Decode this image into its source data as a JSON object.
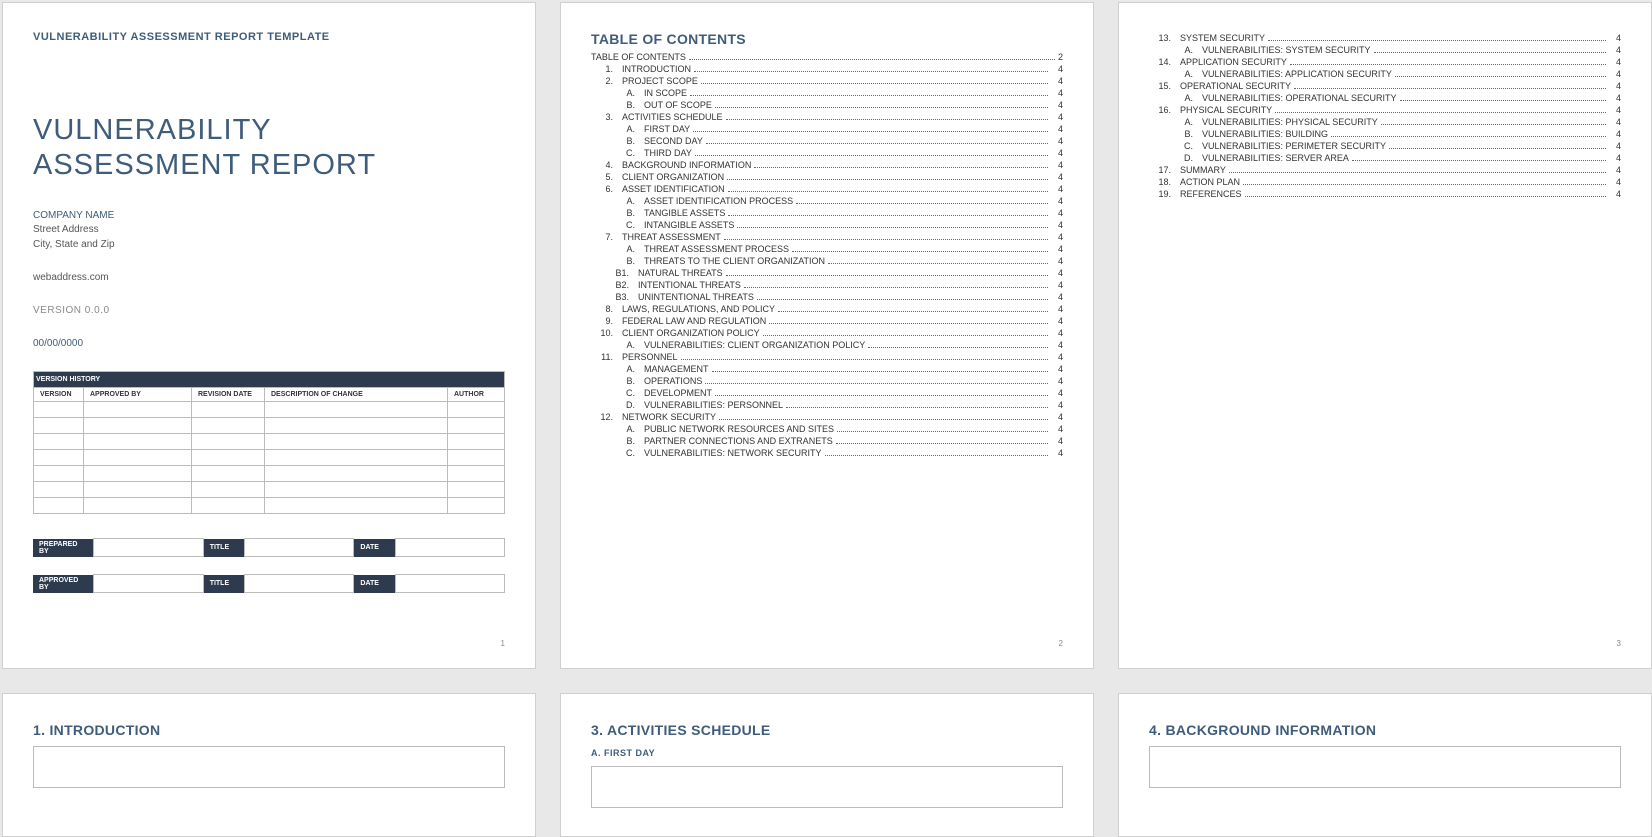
{
  "page1": {
    "header": "VULNERABILITY ASSESSMENT REPORT TEMPLATE",
    "title_line1": "VULNERABILITY",
    "title_line2": "ASSESSMENT REPORT",
    "company": "COMPANY NAME",
    "street": "Street Address",
    "citystatezip": "City, State and Zip",
    "web": "webaddress.com",
    "version": "VERSION 0.0.0",
    "date": "00/00/0000",
    "version_history": {
      "title": "VERSION HISTORY",
      "columns": [
        "VERSION",
        "APPROVED BY",
        "REVISION DATE",
        "DESCRIPTION OF CHANGE",
        "AUTHOR"
      ],
      "rows": [
        [
          "",
          "",
          "",
          "",
          ""
        ],
        [
          "",
          "",
          "",
          "",
          ""
        ],
        [
          "",
          "",
          "",
          "",
          ""
        ],
        [
          "",
          "",
          "",
          "",
          ""
        ],
        [
          "",
          "",
          "",
          "",
          ""
        ],
        [
          "",
          "",
          "",
          "",
          ""
        ],
        [
          "",
          "",
          "",
          "",
          ""
        ]
      ]
    },
    "signoff": {
      "prepared_by": "PREPARED BY",
      "approved_by": "APPROVED BY",
      "title": "TITLE",
      "date": "DATE"
    }
  },
  "toc": {
    "title": "TABLE OF CONTENTS",
    "table_of_contents_self": {
      "label": "TABLE OF CONTENTS",
      "page": "2"
    },
    "page2": [
      {
        "num": "1.",
        "label": "INTRODUCTION",
        "page": "4"
      },
      {
        "num": "2.",
        "label": "PROJECT SCOPE",
        "page": "4"
      },
      {
        "num": "A.",
        "label": "IN SCOPE",
        "page": "4",
        "sub": true
      },
      {
        "num": "B.",
        "label": "OUT OF SCOPE",
        "page": "4",
        "sub": true
      },
      {
        "num": "3.",
        "label": "ACTIVITIES SCHEDULE",
        "page": "4"
      },
      {
        "num": "A.",
        "label": "FIRST DAY",
        "page": "4",
        "sub": true
      },
      {
        "num": "B.",
        "label": "SECOND DAY",
        "page": "4",
        "sub": true
      },
      {
        "num": "C.",
        "label": "THIRD DAY",
        "page": "4",
        "sub": true
      },
      {
        "num": "4.",
        "label": "BACKGROUND INFORMATION",
        "page": "4"
      },
      {
        "num": "5.",
        "label": "CLIENT ORGANIZATION",
        "page": "4"
      },
      {
        "num": "6.",
        "label": "ASSET IDENTIFICATION",
        "page": "4"
      },
      {
        "num": "A.",
        "label": "ASSET IDENTIFICATION PROCESS",
        "page": "4",
        "sub": true
      },
      {
        "num": "B.",
        "label": "TANGIBLE ASSETS",
        "page": "4",
        "sub": true
      },
      {
        "num": "C.",
        "label": "INTANGIBLE ASSETS",
        "page": "4",
        "sub": true
      },
      {
        "num": "7.",
        "label": "THREAT ASSESSMENT",
        "page": "4"
      },
      {
        "num": "A.",
        "label": "THREAT ASSESSMENT PROCESS",
        "page": "4",
        "sub": true
      },
      {
        "num": "B.",
        "label": "THREATS TO THE CLIENT ORGANIZATION",
        "page": "4",
        "sub": true
      },
      {
        "num": "B1.",
        "label": "NATURAL THREATS",
        "page": "4",
        "sub2": true
      },
      {
        "num": "B2.",
        "label": "INTENTIONAL THREATS",
        "page": "4",
        "sub2": true
      },
      {
        "num": "B3.",
        "label": "UNINTENTIONAL THREATS",
        "page": "4",
        "sub2": true
      },
      {
        "num": "8.",
        "label": "LAWS, REGULATIONS, AND POLICY",
        "page": "4"
      },
      {
        "num": "9.",
        "label": "FEDERAL LAW AND REGULATION",
        "page": "4"
      },
      {
        "num": "10.",
        "label": "CLIENT ORGANIZATION POLICY",
        "page": "4"
      },
      {
        "num": "A.",
        "label": "VULNERABILITIES: CLIENT ORGANIZATION POLICY",
        "page": "4",
        "sub": true
      },
      {
        "num": "11.",
        "label": "PERSONNEL",
        "page": "4"
      },
      {
        "num": "A.",
        "label": "MANAGEMENT",
        "page": "4",
        "sub": true
      },
      {
        "num": "B.",
        "label": "OPERATIONS",
        "page": "4",
        "sub": true
      },
      {
        "num": "C.",
        "label": "DEVELOPMENT",
        "page": "4",
        "sub": true
      },
      {
        "num": "D.",
        "label": "VULNERABILITIES: PERSONNEL",
        "page": "4",
        "sub": true
      },
      {
        "num": "12.",
        "label": "NETWORK SECURITY",
        "page": "4"
      },
      {
        "num": "A.",
        "label": "PUBLIC NETWORK RESOURCES AND SITES",
        "page": "4",
        "sub": true
      },
      {
        "num": "B.",
        "label": "PARTNER CONNECTIONS AND EXTRANETS",
        "page": "4",
        "sub": true
      },
      {
        "num": "C.",
        "label": "VULNERABILITIES: NETWORK SECURITY",
        "page": "4",
        "sub": true
      }
    ],
    "page3": [
      {
        "num": "13.",
        "label": "SYSTEM SECURITY",
        "page": "4"
      },
      {
        "num": "A.",
        "label": "VULNERABILITIES: SYSTEM SECURITY",
        "page": "4",
        "sub": true
      },
      {
        "num": "14.",
        "label": "APPLICATION SECURITY",
        "page": "4"
      },
      {
        "num": "A.",
        "label": "VULNERABILITIES: APPLICATION SECURITY",
        "page": "4",
        "sub": true
      },
      {
        "num": "15.",
        "label": "OPERATIONAL SECURITY",
        "page": "4"
      },
      {
        "num": "A.",
        "label": "VULNERABILITIES: OPERATIONAL SECURITY",
        "page": "4",
        "sub": true
      },
      {
        "num": "16.",
        "label": "PHYSICAL SECURITY",
        "page": "4"
      },
      {
        "num": "A.",
        "label": "VULNERABILITIES: PHYSICAL SECURITY",
        "page": "4",
        "sub": true
      },
      {
        "num": "B.",
        "label": "VULNERABILITIES: BUILDING",
        "page": "4",
        "sub": true
      },
      {
        "num": "C.",
        "label": "VULNERABILITIES: PERIMETER SECURITY",
        "page": "4",
        "sub": true
      },
      {
        "num": "D.",
        "label": "VULNERABILITIES: SERVER AREA",
        "page": "4",
        "sub": true
      },
      {
        "num": "17.",
        "label": "SUMMARY",
        "page": "4"
      },
      {
        "num": "18.",
        "label": "ACTION PLAN",
        "page": "4"
      },
      {
        "num": "19.",
        "label": "REFERENCES",
        "page": "4"
      }
    ]
  },
  "page4": {
    "heading": "1. INTRODUCTION"
  },
  "page5": {
    "heading": "3. ACTIVITIES SCHEDULE",
    "sub": "A.  FIRST DAY"
  },
  "page6": {
    "heading": "4. BACKGROUND INFORMATION"
  },
  "page_numbers": {
    "p1": "1",
    "p2": "2",
    "p3": "3"
  }
}
